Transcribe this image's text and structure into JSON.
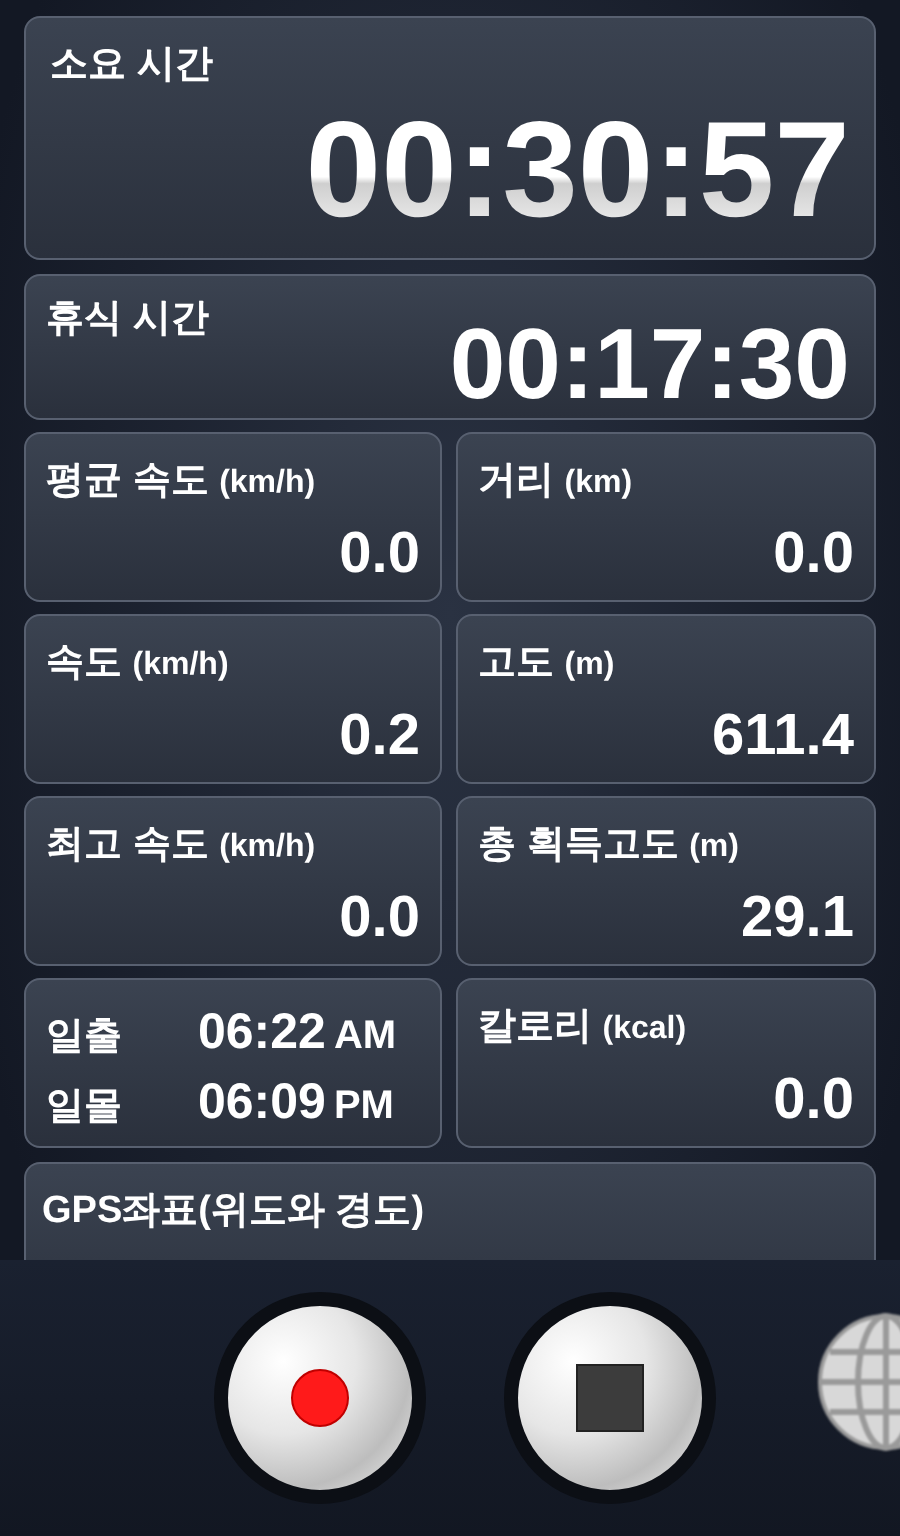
{
  "elapsed": {
    "label": "소요 시간",
    "value": "00:30:57"
  },
  "rest": {
    "label": "휴식 시간",
    "value": "00:17:30"
  },
  "cells": [
    {
      "kind": "metric",
      "label": "평균 속도",
      "unit": "(km/h)",
      "value": "0.0"
    },
    {
      "kind": "metric",
      "label": "거리",
      "unit": "(km)",
      "value": "0.0"
    },
    {
      "kind": "metric",
      "label": "속도",
      "unit": "(km/h)",
      "value": "0.2"
    },
    {
      "kind": "metric",
      "label": "고도",
      "unit": "(m)",
      "value": "611.4"
    },
    {
      "kind": "metric",
      "label": "최고 속도",
      "unit": "(km/h)",
      "value": "0.0"
    },
    {
      "kind": "metric",
      "label": "총 획득고도",
      "unit": "(m)",
      "value": "29.1"
    },
    {
      "kind": "sun",
      "rows": [
        {
          "label": "일출",
          "time": "06:22",
          "suffix": "AM"
        },
        {
          "label": "일몰",
          "time": "06:09",
          "suffix": "PM"
        }
      ]
    },
    {
      "kind": "metric",
      "label": "칼로리",
      "unit": "(kcal)",
      "value": "0.0"
    }
  ],
  "gps": {
    "label": "GPS좌표(위도와 경도)"
  },
  "controls": [
    {
      "kind": "record"
    },
    {
      "kind": "stop"
    },
    {
      "kind": "globe"
    }
  ]
}
